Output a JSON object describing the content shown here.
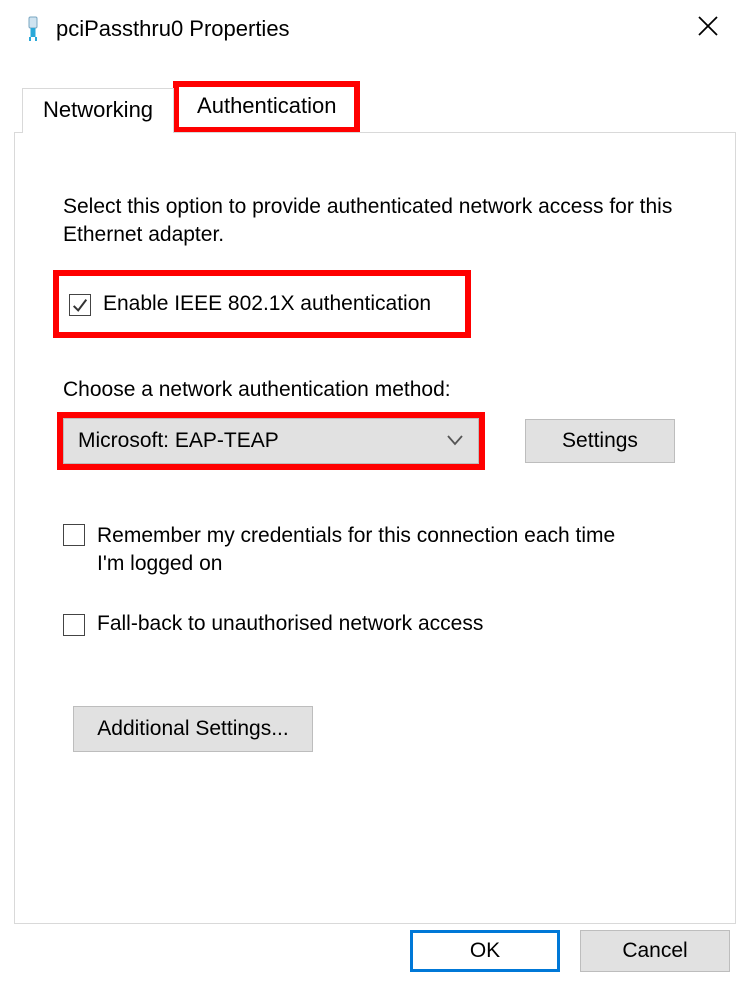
{
  "titlebar": {
    "title": "pciPassthru0 Properties"
  },
  "tabs": {
    "networking": "Networking",
    "authentication": "Authentication"
  },
  "panel": {
    "intro": "Select this option to provide authenticated network access for this Ethernet adapter.",
    "enable8021x": "Enable IEEE 802.1X authentication",
    "choose_method_label": "Choose a network authentication method:",
    "method_value": "Microsoft: EAP-TEAP",
    "settings_button": "Settings",
    "remember_creds": "Remember my credentials for this connection each time I'm logged on",
    "fallback": "Fall-back to unauthorised network access",
    "additional_settings": "Additional Settings..."
  },
  "footer": {
    "ok": "OK",
    "cancel": "Cancel"
  }
}
